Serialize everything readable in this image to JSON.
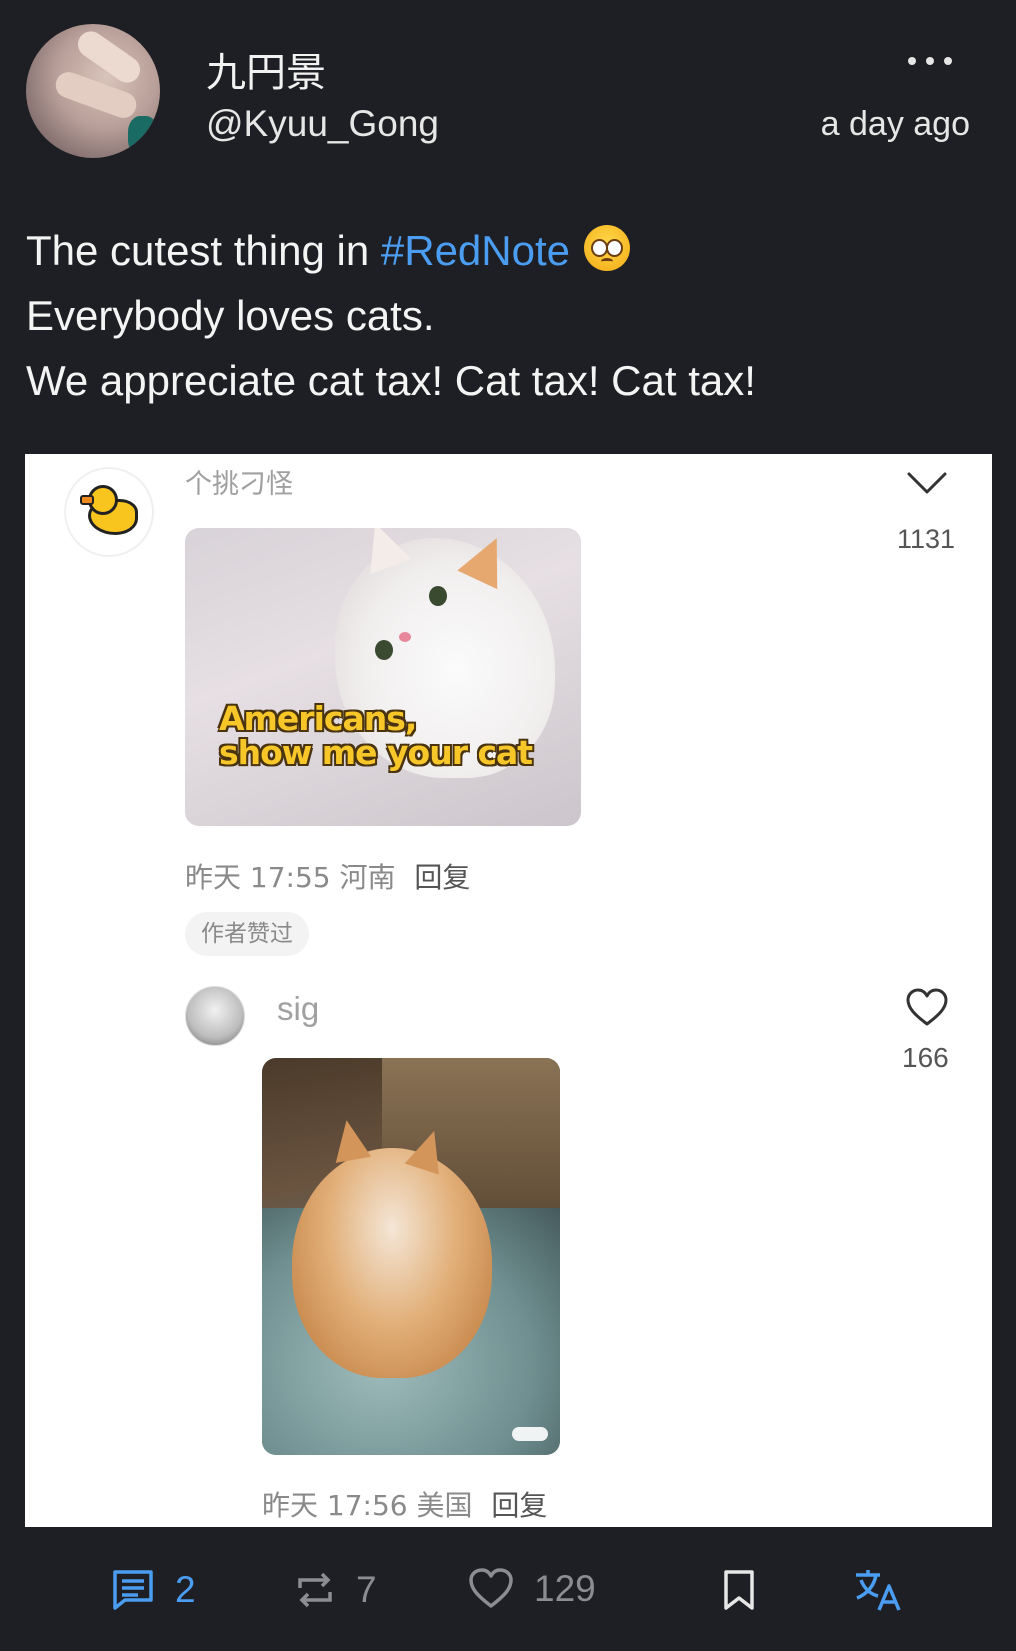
{
  "post": {
    "display_name": "九円景",
    "handle": "@Kyuu_Gong",
    "timestamp": "a day ago",
    "text_line1": "The cutest thing in ",
    "hashtag": "#RedNote",
    "emoji": "pleading-face-emoji",
    "text_line2": "Everybody loves cats.",
    "text_line3": "We appreciate cat tax! Cat tax! Cat tax!"
  },
  "embed": {
    "comment1": {
      "username": "个挑刁怪",
      "likes": "1131",
      "image_caption_line1": "Americans,",
      "image_caption_line2": "show me your cat",
      "time": "昨天 17:55",
      "location": "河南",
      "reply": "回复",
      "author_badge": "作者赞过"
    },
    "comment2": {
      "username": "sig",
      "likes": "166",
      "time": "昨天 17:56",
      "location": "美国",
      "reply": "回复"
    }
  },
  "actions": {
    "comments": "2",
    "reposts": "7",
    "likes": "129"
  },
  "colors": {
    "background": "#1e1f24",
    "accent": "#4a9df0",
    "muted": "#8b8d92"
  }
}
